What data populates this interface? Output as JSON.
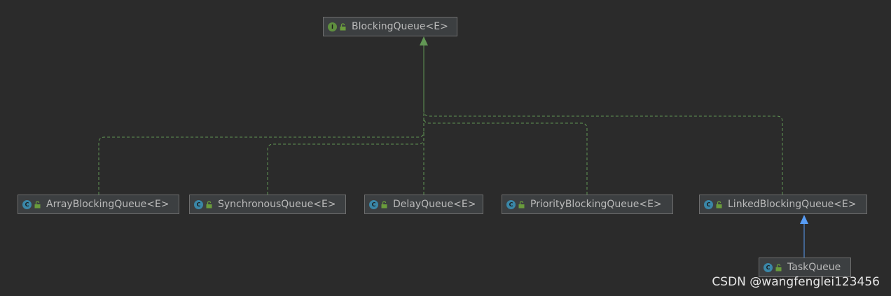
{
  "colors": {
    "background": "#2b2b2b",
    "implements_edge": "#629755",
    "extends_edge": "#589df6",
    "class_badge": "#3a87a8",
    "interface_badge": "#5f8f3f"
  },
  "nodes": [
    {
      "id": "blocking-queue",
      "kind": "interface",
      "badge_icon": "interface-icon",
      "label": "BlockingQueue<E>"
    },
    {
      "id": "array-blocking-queue",
      "kind": "class",
      "badge_icon": "class-icon",
      "label": "ArrayBlockingQueue<E>"
    },
    {
      "id": "synchronous-queue",
      "kind": "class",
      "badge_icon": "class-icon",
      "label": "SynchronousQueue<E>"
    },
    {
      "id": "delay-queue",
      "kind": "class",
      "badge_icon": "class-icon",
      "label": "DelayQueue<E>"
    },
    {
      "id": "priority-blocking-queue",
      "kind": "class",
      "badge_icon": "class-icon",
      "label": "PriorityBlockingQueue<E>"
    },
    {
      "id": "linked-blocking-queue",
      "kind": "class",
      "badge_icon": "class-icon",
      "label": "LinkedBlockingQueue<E>"
    },
    {
      "id": "task-queue",
      "kind": "class",
      "badge_icon": "class-icon",
      "label": "TaskQueue"
    }
  ],
  "edges": [
    {
      "from": "array-blocking-queue",
      "to": "blocking-queue",
      "type": "implements"
    },
    {
      "from": "synchronous-queue",
      "to": "blocking-queue",
      "type": "implements"
    },
    {
      "from": "delay-queue",
      "to": "blocking-queue",
      "type": "implements"
    },
    {
      "from": "priority-blocking-queue",
      "to": "blocking-queue",
      "type": "implements"
    },
    {
      "from": "linked-blocking-queue",
      "to": "blocking-queue",
      "type": "implements"
    },
    {
      "from": "task-queue",
      "to": "linked-blocking-queue",
      "type": "extends"
    }
  ],
  "watermark": "CSDN @wangfenglei123456"
}
